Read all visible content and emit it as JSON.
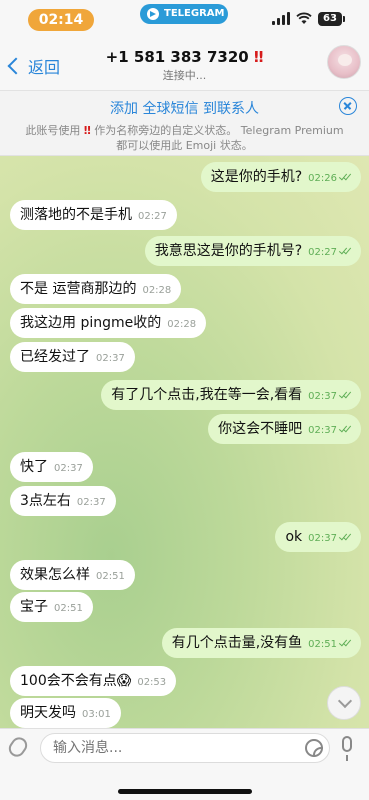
{
  "status_bar": {
    "time": "02:14",
    "app_label": "TELEGRAM",
    "battery": "63"
  },
  "header": {
    "back_label": "返回",
    "title": "+1 581 383 7320",
    "title_mark": "‼",
    "subtitle": "连接中..."
  },
  "banner": {
    "link_text": "添加 全球短信 到联系人",
    "note_prefix": "此账号使用",
    "note_mark": "‼",
    "note_suffix": "作为名称旁边的自定义状态。 Telegram Premium 都可以使用此 Emoji 状态。"
  },
  "messages": [
    {
      "dir": "out",
      "text": "这是你的手机?",
      "time": "02:26"
    },
    {
      "dir": "in",
      "text": "测落地的不是手机",
      "time": "02:27"
    },
    {
      "dir": "out",
      "text": "我意思这是你的手机号?",
      "time": "02:27"
    },
    {
      "dir": "in",
      "text": "不是 运营商那边的",
      "time": "02:28"
    },
    {
      "dir": "in",
      "text": "我这边用 pingme收的",
      "time": "02:28"
    },
    {
      "dir": "in",
      "text": "已经发过了",
      "time": "02:37"
    },
    {
      "dir": "out",
      "text": "有了几个点击,我在等一会,看看",
      "time": "02:37"
    },
    {
      "dir": "out",
      "text": "你这会不睡吧",
      "time": "02:37"
    },
    {
      "dir": "in",
      "text": "快了",
      "time": "02:37"
    },
    {
      "dir": "in",
      "text": "3点左右",
      "time": "02:37"
    },
    {
      "dir": "out",
      "text": "ok",
      "time": "02:37"
    },
    {
      "dir": "in",
      "text": "效果怎么样",
      "time": "02:51"
    },
    {
      "dir": "in",
      "text": "宝子",
      "time": "02:51"
    },
    {
      "dir": "out",
      "text": "有几个点击量,没有鱼",
      "time": "02:51"
    },
    {
      "dir": "in",
      "text": "100会不会有点😱",
      "time": "02:53"
    },
    {
      "dir": "in",
      "text": "明天发吗",
      "time": "03:01"
    }
  ],
  "composer": {
    "placeholder": "输入消息..."
  }
}
